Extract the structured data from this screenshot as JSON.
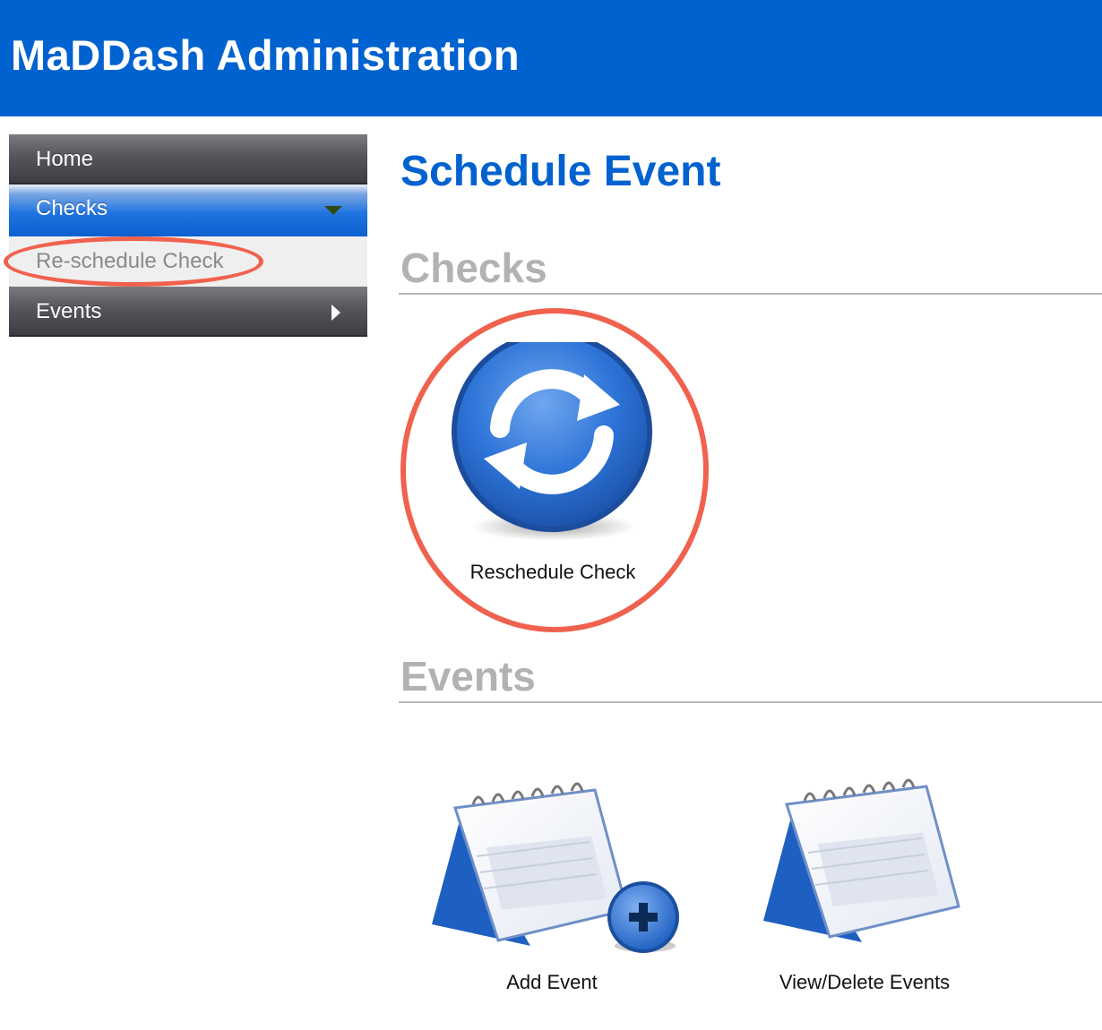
{
  "header": {
    "title": "MaDDash Administration"
  },
  "sidebar": {
    "items": [
      {
        "label": "Home"
      },
      {
        "label": "Checks"
      },
      {
        "label": "Re-schedule Check"
      },
      {
        "label": "Events"
      }
    ]
  },
  "main": {
    "title": "Schedule Event",
    "sections": [
      {
        "title": "Checks",
        "tiles": [
          {
            "label": "Reschedule Check",
            "icon": "refresh-icon"
          }
        ]
      },
      {
        "title": "Events",
        "tiles": [
          {
            "label": "Add Event",
            "icon": "calendar-add-icon"
          },
          {
            "label": "View/Delete Events",
            "icon": "calendar-icon"
          }
        ]
      }
    ]
  },
  "colors": {
    "brand": "#0062cf",
    "highlight": "#f0614e",
    "section_gray": "#b2b2b2"
  }
}
